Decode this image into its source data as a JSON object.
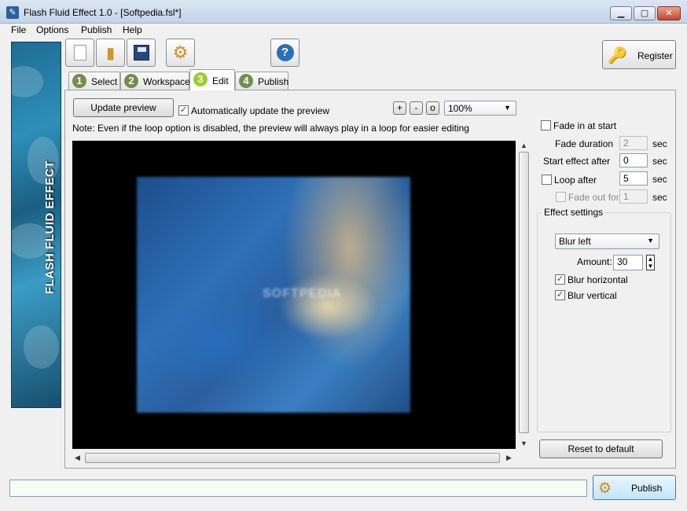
{
  "window": {
    "title": "Flash Fluid Effect 1.0 - [Softpedia.fsl*]"
  },
  "menu": [
    "File",
    "Options",
    "Publish",
    "Help"
  ],
  "banner": {
    "text": "FLASH FLUID EFFECT"
  },
  "register": {
    "label": "Register"
  },
  "tabs": [
    {
      "num": "1",
      "label": "Select"
    },
    {
      "num": "2",
      "label": "Workspace"
    },
    {
      "num": "3",
      "label": "Edit"
    },
    {
      "num": "4",
      "label": "Publish"
    }
  ],
  "edit": {
    "update_preview": "Update preview",
    "auto_update_label": "Automatically update the preview",
    "auto_update_checked": true,
    "zoom_plus": "+",
    "zoom_minus": "-",
    "zoom_reset": "o",
    "zoom_value": "100%",
    "note": "Note: Even if the loop option is disabled, the preview will always play in a loop for easier editing"
  },
  "settings": {
    "fade_in_label": "Fade in at start",
    "fade_duration_label": "Fade duration",
    "fade_duration_value": "2",
    "start_after_label": "Start effect after",
    "start_after_value": "0",
    "loop_label": "Loop after",
    "loop_value": "5",
    "fade_out_label": "Fade out for",
    "fade_out_value": "1",
    "sec": "sec"
  },
  "effect": {
    "group_title": "Effect settings",
    "type": "Blur left",
    "amount_label": "Amount:",
    "amount_value": "30",
    "blur_h_label": "Blur horizontal",
    "blur_v_label": "Blur vertical",
    "reset_label": "Reset to default"
  },
  "bottom": {
    "publish_label": "Publish"
  },
  "preview": {
    "watermark": "SOFTPEDIA"
  }
}
